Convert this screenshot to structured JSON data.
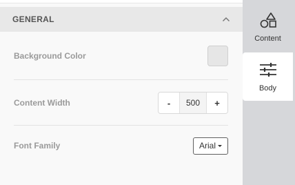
{
  "section": {
    "title": "GENERAL"
  },
  "settings": {
    "background_color": {
      "label": "Background Color",
      "value": "#e6e6e6"
    },
    "content_width": {
      "label": "Content Width",
      "decrement": "-",
      "value": "500",
      "increment": "+"
    },
    "font_family": {
      "label": "Font Family",
      "value": "Arial"
    }
  },
  "sidebar": {
    "tabs": [
      {
        "label": "Content",
        "icon": "shapes-icon",
        "active": false
      },
      {
        "label": "Body",
        "icon": "sliders-icon",
        "active": true
      }
    ]
  }
}
